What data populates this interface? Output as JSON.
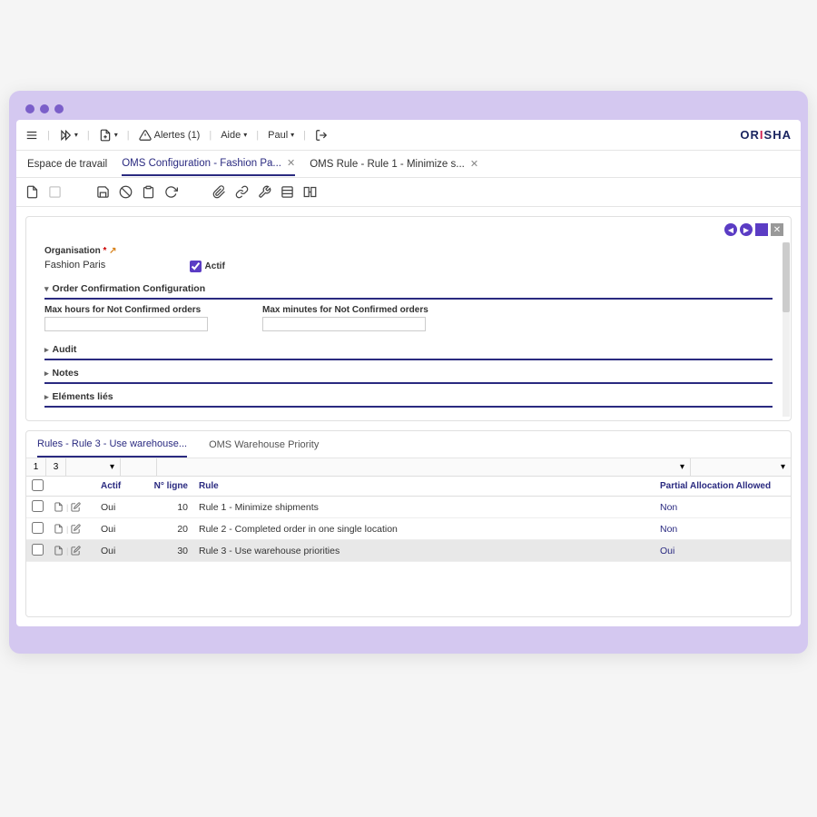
{
  "brand": {
    "text": "ORISHA"
  },
  "toolbar": {
    "alerts_label": "Alertes (1)",
    "help_label": "Aide",
    "user_label": "Paul"
  },
  "tabs": [
    {
      "label": "Espace de travail",
      "closable": false,
      "active": false
    },
    {
      "label": "OMS Configuration - Fashion Pa...",
      "closable": true,
      "active": true
    },
    {
      "label": "OMS Rule - Rule 1 - Minimize s...",
      "closable": true,
      "active": false
    }
  ],
  "form": {
    "org_label": "Organisation",
    "org_value": "Fashion Paris",
    "actif_label": "Actif",
    "actif_checked": true,
    "section_order_conf": "Order Confirmation Configuration",
    "max_hours_label": "Max hours for Not Confirmed orders",
    "max_minutes_label": "Max minutes for Not Confirmed orders",
    "section_audit": "Audit",
    "section_notes": "Notes",
    "section_linked": "Eléments liés"
  },
  "subtabs": [
    {
      "label": "Rules - Rule 3 - Use warehouse...",
      "active": true
    },
    {
      "label": "OMS Warehouse Priority",
      "active": false
    }
  ],
  "paging": {
    "page": "1",
    "total": "3"
  },
  "columns": {
    "actif": "Actif",
    "line": "N° ligne",
    "rule": "Rule",
    "partial": "Partial Allocation Allowed"
  },
  "rows": [
    {
      "actif": "Oui",
      "line": "10",
      "rule": "Rule 1 - Minimize shipments",
      "partial": "Non",
      "selected": false
    },
    {
      "actif": "Oui",
      "line": "20",
      "rule": "Rule 2 - Completed order in one single location",
      "partial": "Non",
      "selected": false
    },
    {
      "actif": "Oui",
      "line": "30",
      "rule": "Rule 3 - Use warehouse priorities",
      "partial": "Oui",
      "selected": true
    }
  ]
}
